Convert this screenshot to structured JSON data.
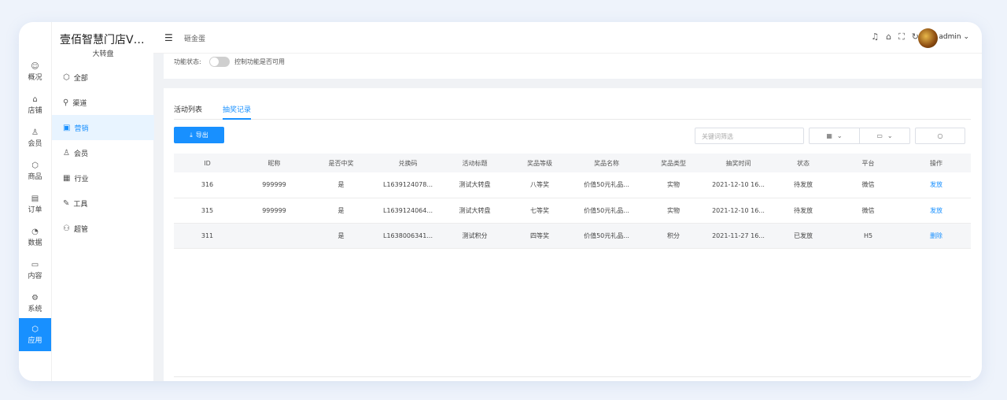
{
  "brand": {
    "title": "壹佰智慧门店V2...",
    "subtitle": "大转盘"
  },
  "nav1": [
    {
      "icon": "☺",
      "label": "概况"
    },
    {
      "icon": "⌂",
      "label": "店铺"
    },
    {
      "icon": "♙",
      "label": "会员"
    },
    {
      "icon": "⬡",
      "label": "商品"
    },
    {
      "icon": "▤",
      "label": "订单"
    },
    {
      "icon": "◔",
      "label": "数据"
    },
    {
      "icon": "▭",
      "label": "内容"
    },
    {
      "icon": "⚙",
      "label": "系统"
    },
    {
      "icon": "⬡",
      "label": "应用"
    }
  ],
  "nav2": [
    {
      "icon": "⬡",
      "label": "全部"
    },
    {
      "icon": "⚲",
      "label": "渠道"
    },
    {
      "icon": "▣",
      "label": "营销"
    },
    {
      "icon": "♙",
      "label": "会员"
    },
    {
      "icon": "▦",
      "label": "行业"
    },
    {
      "icon": "✎",
      "label": "工具"
    },
    {
      "icon": "⚇",
      "label": "超管"
    }
  ],
  "header": {
    "breadcrumb": "砸金蛋",
    "user": "admin"
  },
  "status": {
    "label": "功能状态:",
    "hint": "控制功能是否可用"
  },
  "tabs": [
    "活动列表",
    "抽奖记录"
  ],
  "toolbar": {
    "export_label": "导出",
    "search_placeholder": "关键词筛选"
  },
  "table": {
    "columns": [
      "ID",
      "昵称",
      "是否中奖",
      "兑换码",
      "活动标题",
      "奖品等级",
      "奖品名称",
      "奖品类型",
      "抽奖时间",
      "状态",
      "平台",
      "操作"
    ],
    "rows": [
      [
        "316",
        "999999",
        "是",
        "L1639124078...",
        "测试大转盘",
        "八等奖",
        "价值50元礼品...",
        "实物",
        "2021-12-10 16...",
        "待发放",
        "微信",
        "发放"
      ],
      [
        "315",
        "999999",
        "是",
        "L1639124064...",
        "测试大转盘",
        "七等奖",
        "价值50元礼品...",
        "实物",
        "2021-12-10 16...",
        "待发放",
        "微信",
        "发放"
      ],
      [
        "311",
        "",
        "是",
        "L1638006341...",
        "测试积分",
        "四等奖",
        "价值50元礼品...",
        "积分",
        "2021-11-27 16...",
        "已发放",
        "H5",
        "删除"
      ]
    ]
  },
  "colors": {
    "primary": "#1890ff"
  }
}
